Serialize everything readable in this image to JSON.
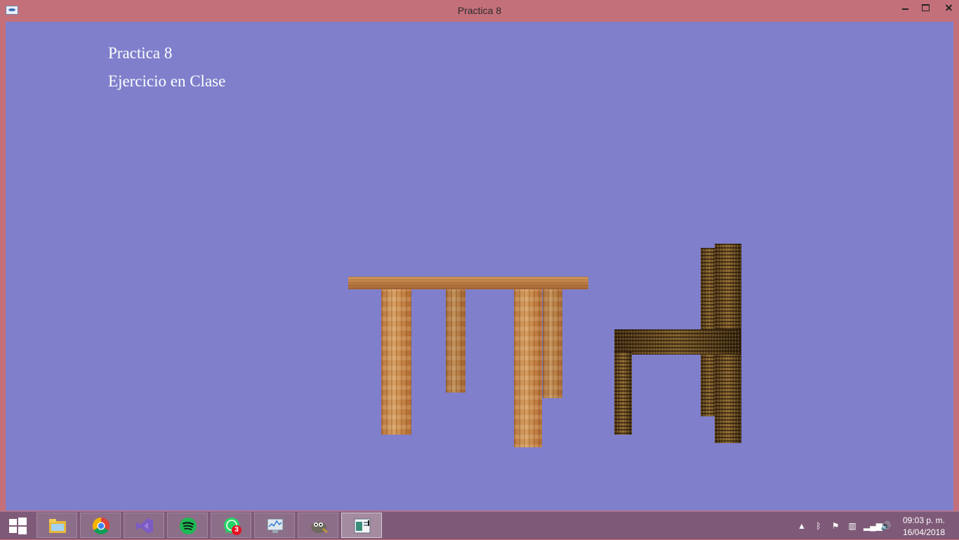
{
  "window": {
    "title": "Practica 8",
    "icon": "opengl-app-icon",
    "controls": [
      "minimize",
      "maximize",
      "close"
    ]
  },
  "scene": {
    "background_color": "#7f7fcc",
    "captions": [
      "Practica 8",
      "Ejercicio en Clase"
    ],
    "objects": [
      "wooden-table",
      "wooden-chair"
    ]
  },
  "taskbar": {
    "apps": [
      {
        "name": "file-explorer-icon"
      },
      {
        "name": "chrome-icon"
      },
      {
        "name": "visual-studio-icon"
      },
      {
        "name": "spotify-icon"
      },
      {
        "name": "whatsapp-icon",
        "badge": "3"
      },
      {
        "name": "system-monitor-icon"
      },
      {
        "name": "gimp-icon"
      },
      {
        "name": "opengl-app-icon",
        "active": true
      }
    ],
    "tray": {
      "icons": [
        "show-hidden-icons-chevron",
        "bluetooth-icon",
        "action-center-flag-icon",
        "network-devices-icon",
        "signal-bars-icon",
        "volume-icon"
      ],
      "time": "09:03 p. m.",
      "date": "16/04/2018"
    }
  }
}
